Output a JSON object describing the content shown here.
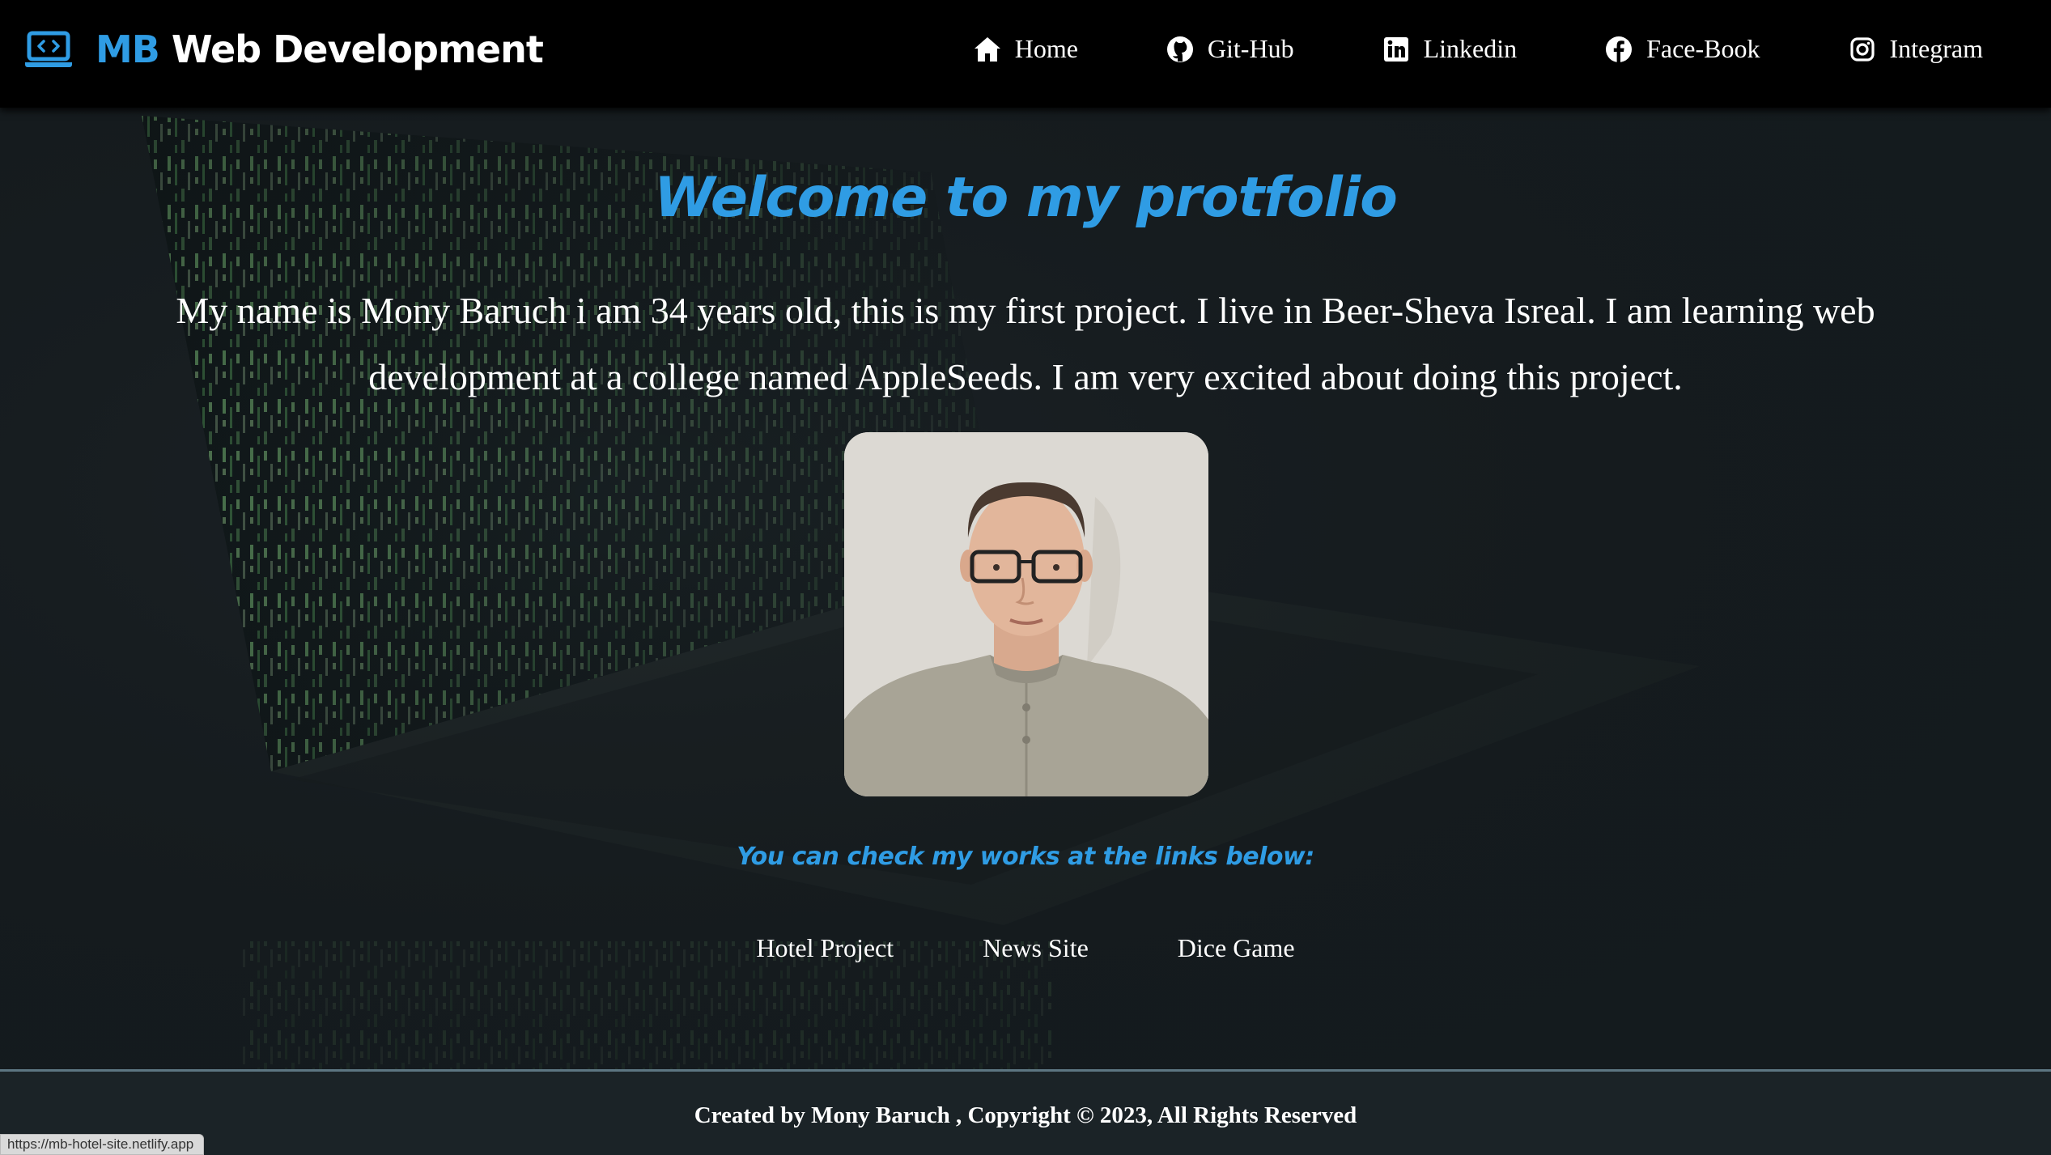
{
  "nav": {
    "brand_accent": "MB",
    "brand_rest": " Web Development",
    "links": [
      {
        "label": "Home",
        "icon": "home-icon"
      },
      {
        "label": "Git-Hub",
        "icon": "github-icon"
      },
      {
        "label": "Linkedin",
        "icon": "linkedin-icon"
      },
      {
        "label": "Face-Book",
        "icon": "facebook-icon"
      },
      {
        "label": "Integram",
        "icon": "instagram-icon"
      }
    ]
  },
  "hero": {
    "title": "Welcome to my protfolio",
    "intro": "My name is Mony Baruch i am 34 years old, this is my first project. I live in Beer-Sheva Isreal. I am learning web development at a college named AppleSeeds. I am very excited about doing this project.",
    "works_label": "You can check my works at the links below:",
    "projects": [
      "Hotel Project",
      "News Site",
      "Dice Game"
    ]
  },
  "footer": {
    "copyright": "Created by Mony Baruch , Copyright © 2023, All Rights Reserved"
  },
  "status_bar": {
    "url": "https://mb-hotel-site.netlify.app"
  },
  "colors": {
    "accent": "#2f9ce4",
    "nav_bg": "#000000",
    "page_bg": "#1b2226",
    "matrix_green": "#8fe08a"
  }
}
